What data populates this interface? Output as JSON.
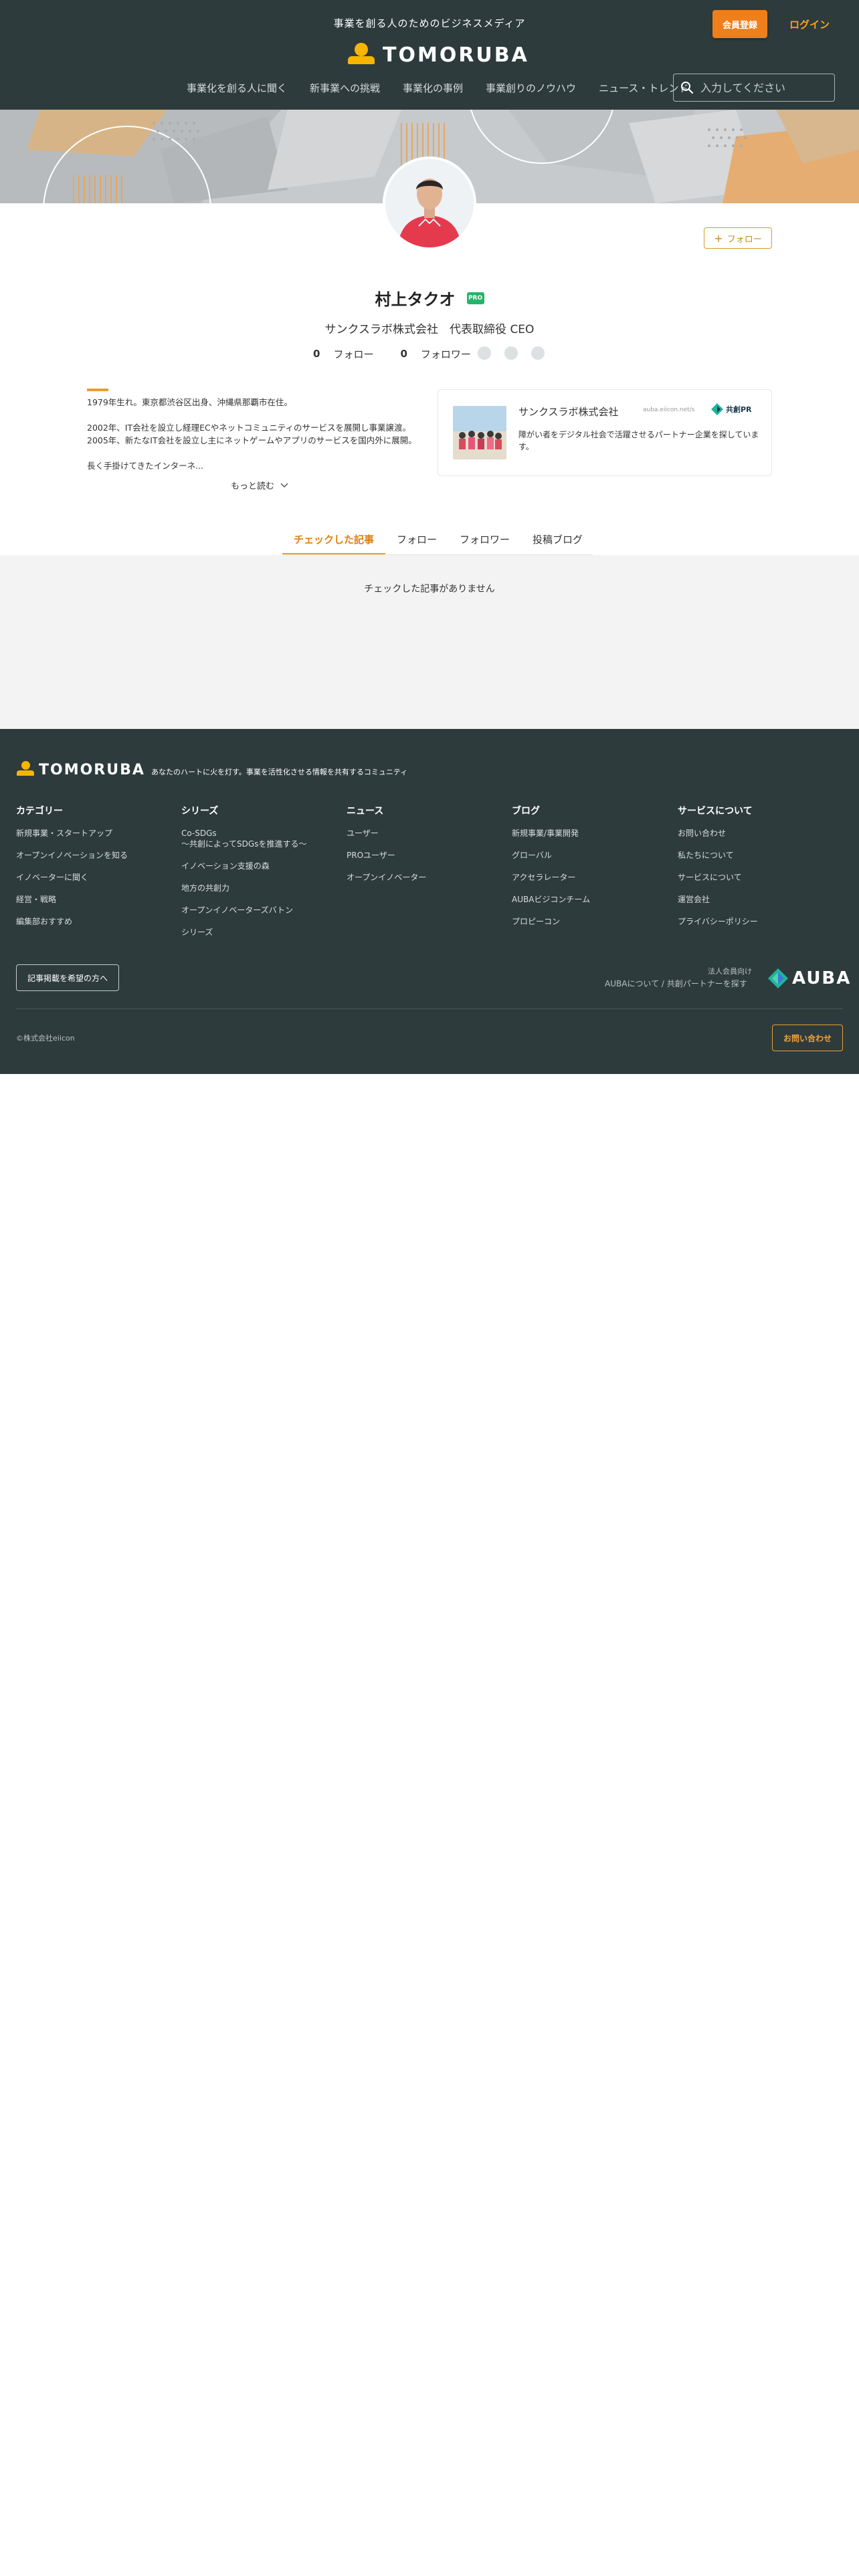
{
  "header": {
    "tagline": "事業を創る人のためのビジネスメディア",
    "logo_text": "TOMORUBA",
    "signup_label": "会員登録",
    "login_label": "ログイン",
    "nav": [
      "事業化を創る人に聞く",
      "新事業への挑戦",
      "事業化の事例",
      "事業創りのノウハウ",
      "ニュース・トレンド"
    ],
    "search_placeholder": "入力してください"
  },
  "profile": {
    "follow_label": "フォロー",
    "name": "村上タクオ",
    "badge": "PRO",
    "title": "サンクスラボ株式会社　代表取締役 CEO",
    "following_count": "0",
    "following_label": "フォロー",
    "follower_count": "0",
    "follower_label": "フォロワー",
    "bio": [
      "1979年生れ。東京都渋谷区出身、沖縄県那覇市在住。",
      "2002年、IT会社を設立し経理ECやネットコミュニティのサービスを展開し事業譲渡。2005年、新たなIT会社を設立し主にネットゲームやアプリのサービスを国内外に展開。",
      "長く手掛けてきたインターネ..."
    ],
    "more_label": "もっと読む"
  },
  "company": {
    "name": "サンクスラボ株式会社",
    "url": "auba.eiicon.net/s",
    "partner_label": "共創PR",
    "description": "障がい者をデジタル社会で活躍させるパートナー企業を探しています。"
  },
  "tabs": [
    "チェックした記事",
    "フォロー",
    "フォロワー",
    "投稿ブログ"
  ],
  "empty_message": "チェックした記事がありません",
  "footer": {
    "logo_text": "TOMORUBA",
    "tagline": "あなたのハートに火を灯す。事業を活性化させる情報を共有するコミュニティ",
    "columns": [
      {
        "title": "カテゴリー",
        "items": [
          "新規事業・スタートアップ",
          "オープンイノベーションを知る",
          "イノベーターに聞く",
          "経営・戦略",
          "編集部おすすめ"
        ]
      },
      {
        "title": "シリーズ",
        "items": [
          "Co-SDGs\n～共創によってSDGsを推進する～",
          "イノベーション支援の森",
          "地方の共創力",
          "オープンイノベーターズバトン",
          "シリーズ"
        ]
      },
      {
        "title": "ニュース",
        "items": [
          "ユーザー",
          "PROユーザー",
          "オープンイノベーター"
        ]
      },
      {
        "title": "ブログ",
        "items": [
          "新規事業/事業開発",
          "グローバル",
          "アクセラレーター",
          "AUBAビジコンチーム",
          "プロピーコン"
        ]
      },
      {
        "title": "サービスについて",
        "items": [
          "お問い合わせ",
          "私たちについて",
          "サービスについて",
          "運営会社",
          "プライバシーポリシー"
        ]
      }
    ],
    "recruit_label": "記事掲載を希望の方へ",
    "auba_sub": "法人会員向け",
    "auba_desc": "AUBAについて / 共創パートナーを探す",
    "auba_logo": "AUBA",
    "copyright": "©株式会社eiicon",
    "contact_label": "お問い合わせ"
  },
  "colors": {
    "header_bg": "#2e3b3d",
    "accent_orange": "#ef7f1a",
    "pro_green": "#27b36a"
  }
}
